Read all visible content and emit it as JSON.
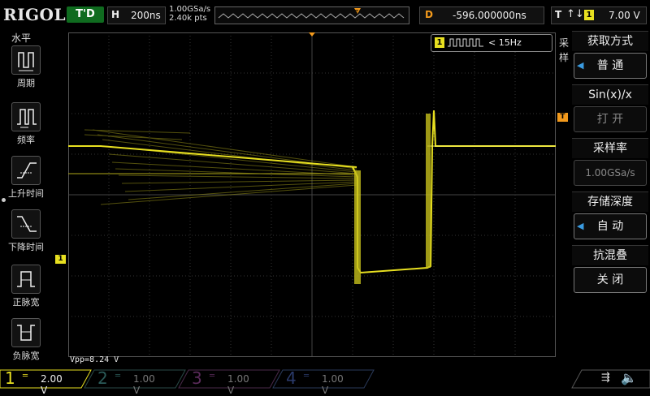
{
  "header": {
    "logo": "RIGOL",
    "run_status": "T'D",
    "timebase_key": "H",
    "timebase_value": "200ns",
    "sample_rate": "1.00GSa/s",
    "memory_points": "2.40k pts",
    "delay_key": "D",
    "delay_value": "-596.000000ns",
    "trigger_key": "T",
    "trigger_edge": "↑↓",
    "trigger_source": "1",
    "trigger_level": "7.00 V"
  },
  "left_menu": {
    "title": "水平",
    "items": [
      {
        "label": "周期",
        "icon": "period-icon"
      },
      {
        "label": "频率",
        "icon": "frequency-icon"
      },
      {
        "label": "上升时间",
        "icon": "rise-time-icon"
      },
      {
        "label": "下降时间",
        "icon": "fall-time-icon"
      },
      {
        "label": "正脉宽",
        "icon": "positive-width-icon"
      },
      {
        "label": "负脉宽",
        "icon": "negative-width-icon"
      }
    ]
  },
  "screen": {
    "ch1_marker": "1",
    "trigger_marker": "T",
    "counter_channel": "1",
    "counter_value": "< 15Hz",
    "measurement": "Vpp=8.24 V"
  },
  "menu_tab": [
    "采",
    "样"
  ],
  "right_menu": [
    {
      "title": "获取方式",
      "value": "普  通",
      "disabled": false,
      "arrow": true
    },
    {
      "title": "Sin(x)/x",
      "value": "打  开",
      "disabled": true,
      "arrow": false
    },
    {
      "title": "采样率",
      "value": "1.00GSa/s",
      "disabled": true,
      "arrow": false
    },
    {
      "title": "存储深度",
      "value": "自  动",
      "disabled": false,
      "arrow": true
    },
    {
      "title": "抗混叠",
      "value": "关  闭",
      "disabled": false,
      "arrow": false
    }
  ],
  "channels": [
    {
      "num": "1",
      "coupling": "═",
      "value": "2.00 V",
      "color": "#e8e020",
      "active": true
    },
    {
      "num": "2",
      "coupling": "═",
      "value": "1.00 V",
      "color": "#2fa6a0",
      "active": false
    },
    {
      "num": "3",
      "coupling": "═",
      "value": "1.00 V",
      "color": "#c040c0",
      "active": false
    },
    {
      "num": "4",
      "coupling": "═",
      "value": "1.00 V",
      "color": "#3b6fd8",
      "active": false
    }
  ],
  "colors": {
    "ch1": "#e8e020",
    "trigger": "#f39a1c",
    "grid": "#3a3a3a"
  }
}
